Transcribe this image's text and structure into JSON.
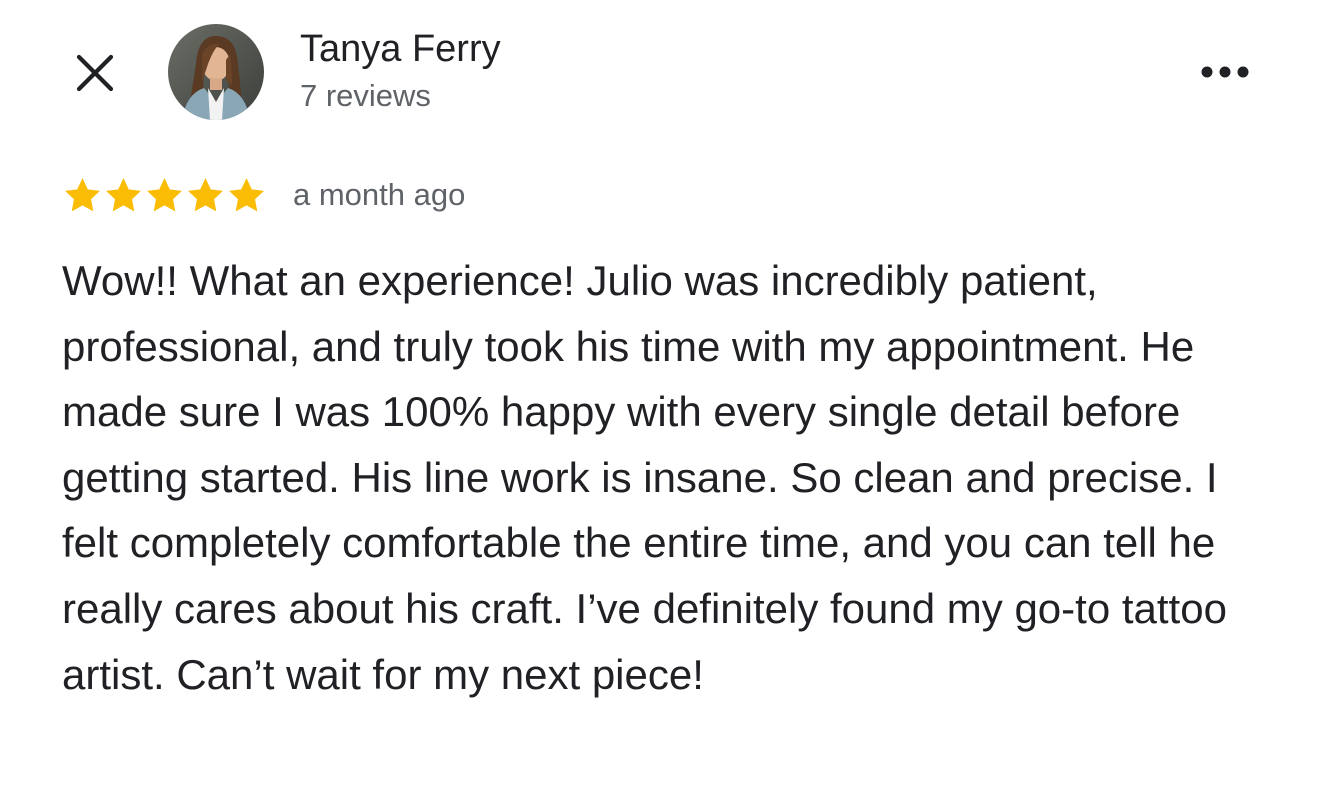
{
  "author": {
    "name": "Tanya Ferry",
    "reviews": "7 reviews"
  },
  "review": {
    "rating": 5,
    "max_rating": 5,
    "date": "a month ago",
    "text": "Wow!! What an experience! Julio was incredibly patient, professional, and truly took his time with my appointment. He made sure I was 100% happy with every single detail before getting started. His line work is insane. So clean and precise. I felt completely comfortable the entire time, and you can tell he really cares about his craft. I’ve definitely found my go-to tattoo artist. Can’t wait for my next piece!"
  },
  "icons": {
    "close": "close-icon",
    "more": "more-horizontal-icon",
    "star": "star-icon"
  },
  "colors": {
    "star": "#fbbc04",
    "text_primary": "#202124",
    "text_secondary": "#5f6368"
  }
}
